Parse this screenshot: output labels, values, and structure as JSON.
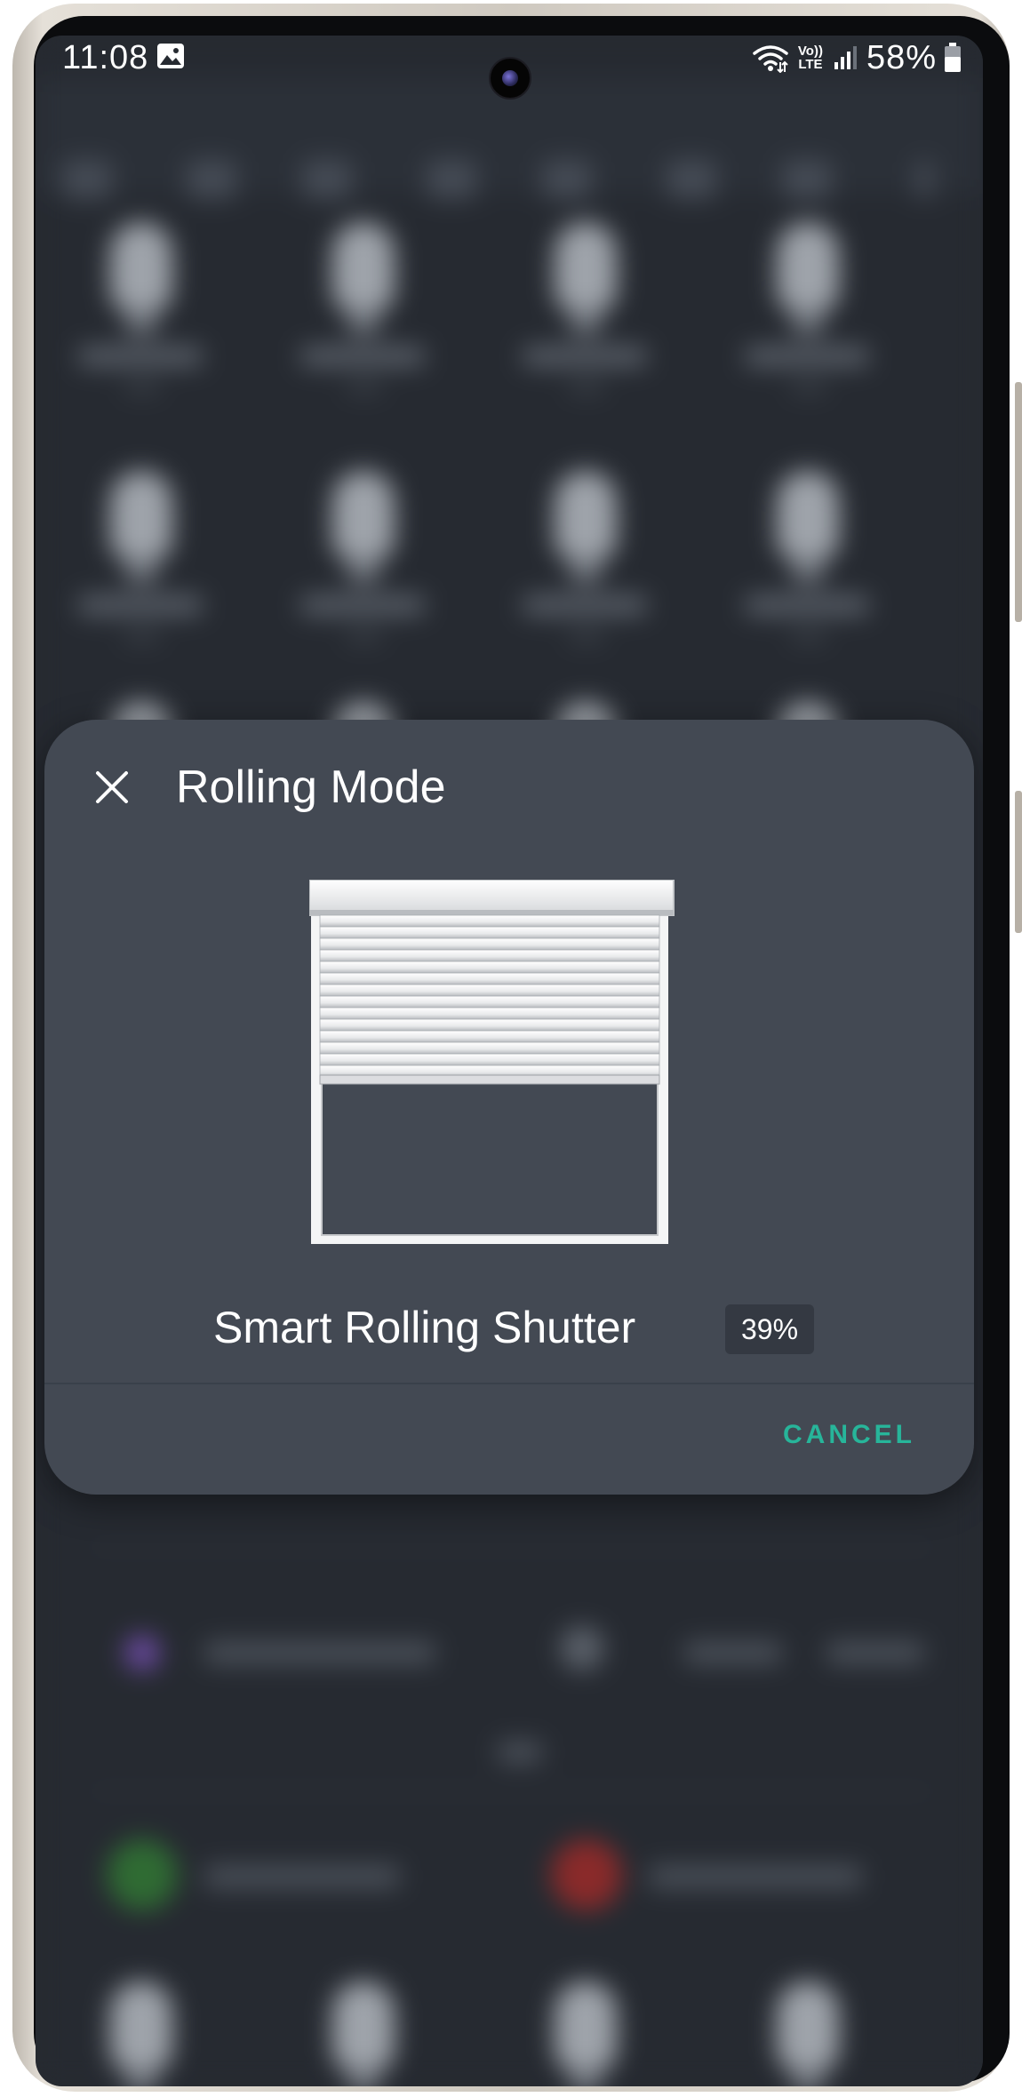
{
  "status_bar": {
    "time": "11:08",
    "lte_top": "Vo))",
    "lte_bottom": "LTE",
    "battery": "58%"
  },
  "dialog": {
    "title": "Rolling Mode",
    "device_name": "Smart Rolling Shutter",
    "position_percent": "39%",
    "cancel_label": "CANCEL",
    "shutter_closed_fraction": 0.39
  },
  "colors": {
    "accent": "#27b59a",
    "dialog_bg": "#434953",
    "screen_bg": "#262a31"
  },
  "icons": {
    "close": "close-icon",
    "gallery": "gallery-icon",
    "wifi": "wifi-icon",
    "signal": "signal-icon",
    "battery": "battery-icon"
  }
}
